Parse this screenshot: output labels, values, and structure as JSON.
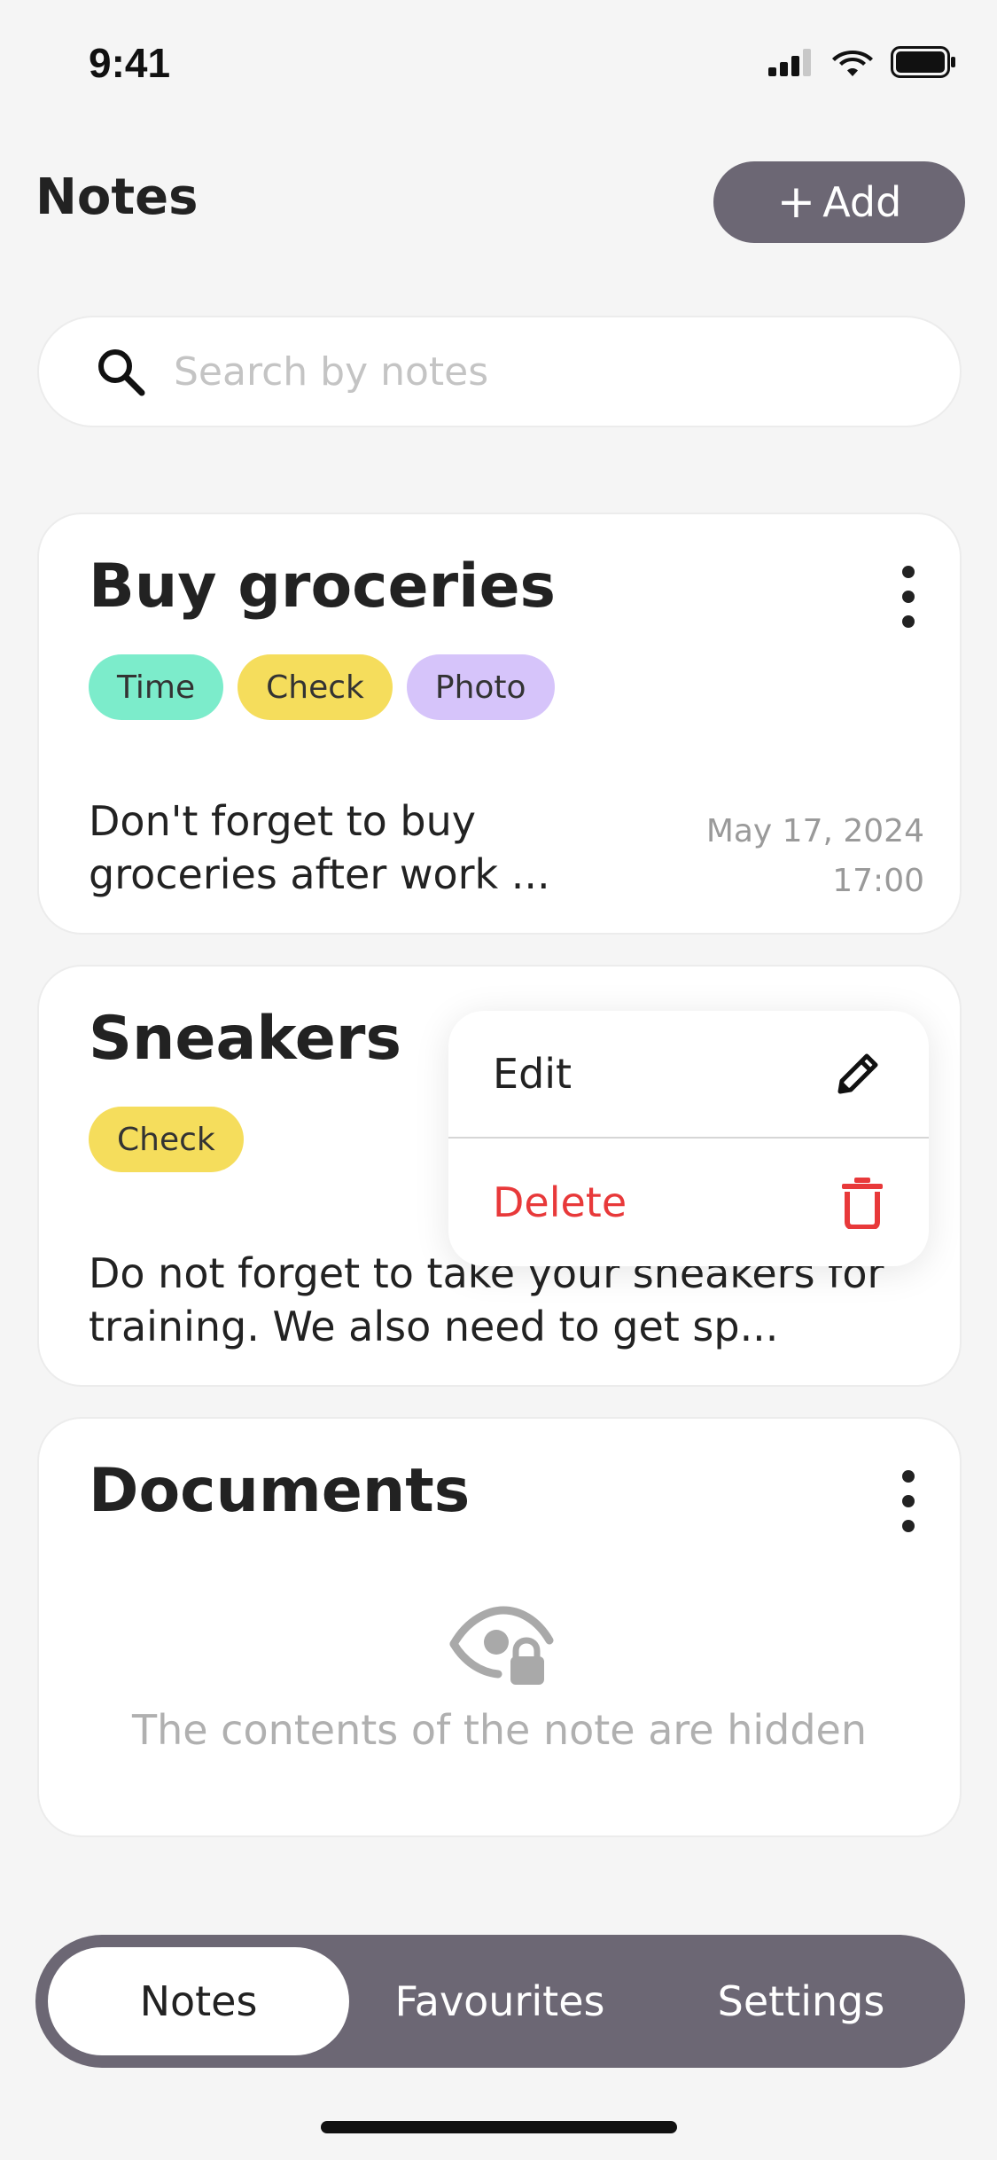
{
  "status_bar": {
    "time": "9:41"
  },
  "header": {
    "title": "Notes",
    "add_label": "Add",
    "add_plus": "+"
  },
  "search": {
    "placeholder": "Search by notes",
    "value": ""
  },
  "notes": [
    {
      "title": "Buy groceries",
      "tags": [
        {
          "label": "Time",
          "color": "#7ceccb"
        },
        {
          "label": "Check",
          "color": "#f5dd5c"
        },
        {
          "label": "Photo",
          "color": "#d6c4fa"
        }
      ],
      "text": "Don't forget to buy groceries after work ...",
      "date": "May 17, 2024",
      "time": "17:00"
    },
    {
      "title": "Sneakers",
      "tags": [
        {
          "label": "Check",
          "color": "#f5dd5c"
        }
      ],
      "text": "Do not forget to take your sneakers for training. We also need to get sp..."
    },
    {
      "title": "Documents",
      "hidden_text": "The contents of the note are hidden"
    }
  ],
  "context_menu": {
    "edit_label": "Edit",
    "delete_label": "Delete"
  },
  "tab_bar": {
    "tabs": [
      {
        "label": "Notes",
        "active": true
      },
      {
        "label": "Favourites",
        "active": false
      },
      {
        "label": "Settings",
        "active": false
      }
    ]
  },
  "colors": {
    "accent": "#6c6774",
    "background": "#f5f5f5",
    "delete": "#e8393a",
    "tag_time": "#7ceccb",
    "tag_check": "#f5dd5c",
    "tag_photo": "#d6c4fa"
  },
  "icons": {
    "signal": "cellular-signal-icon",
    "wifi": "wifi-icon",
    "battery": "battery-icon",
    "search": "search-icon",
    "more": "more-vertical-icon",
    "edit": "pencil-icon",
    "delete": "trash-icon",
    "hidden": "eye-lock-icon"
  }
}
